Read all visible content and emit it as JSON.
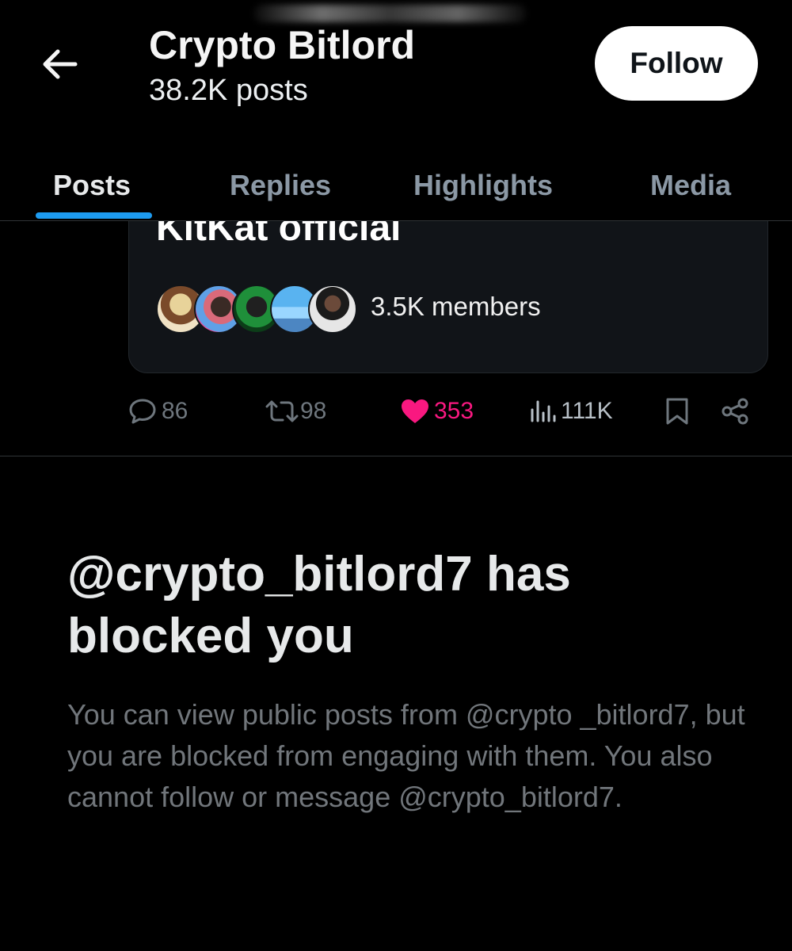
{
  "header": {
    "title": "Crypto Bitlord",
    "subtitle": "38.2K posts",
    "follow_label": "Follow"
  },
  "tabs": [
    {
      "label": "Posts",
      "active": true
    },
    {
      "label": "Replies",
      "active": false
    },
    {
      "label": "Highlights",
      "active": false
    },
    {
      "label": "Media",
      "active": false
    }
  ],
  "community": {
    "name": "KitKat official",
    "members": "3.5K members"
  },
  "actions": {
    "replies": "86",
    "reposts": "98",
    "likes": "353",
    "views": "111K"
  },
  "blocked": {
    "title": "@crypto_bitlord7 has blocked you",
    "description": "You can view public posts from @crypto _bitlord7, but you are blocked from engaging with them. You also cannot follow or message @crypto_bitlord7."
  },
  "colors": {
    "accent": "#1d9bf0",
    "like": "#f91880",
    "background": "#000000",
    "muted": "#71767b"
  },
  "icons": [
    "arrow-left-icon",
    "reply-icon",
    "repost-icon",
    "heart-icon",
    "views-icon",
    "bookmark-icon",
    "share-icon"
  ]
}
